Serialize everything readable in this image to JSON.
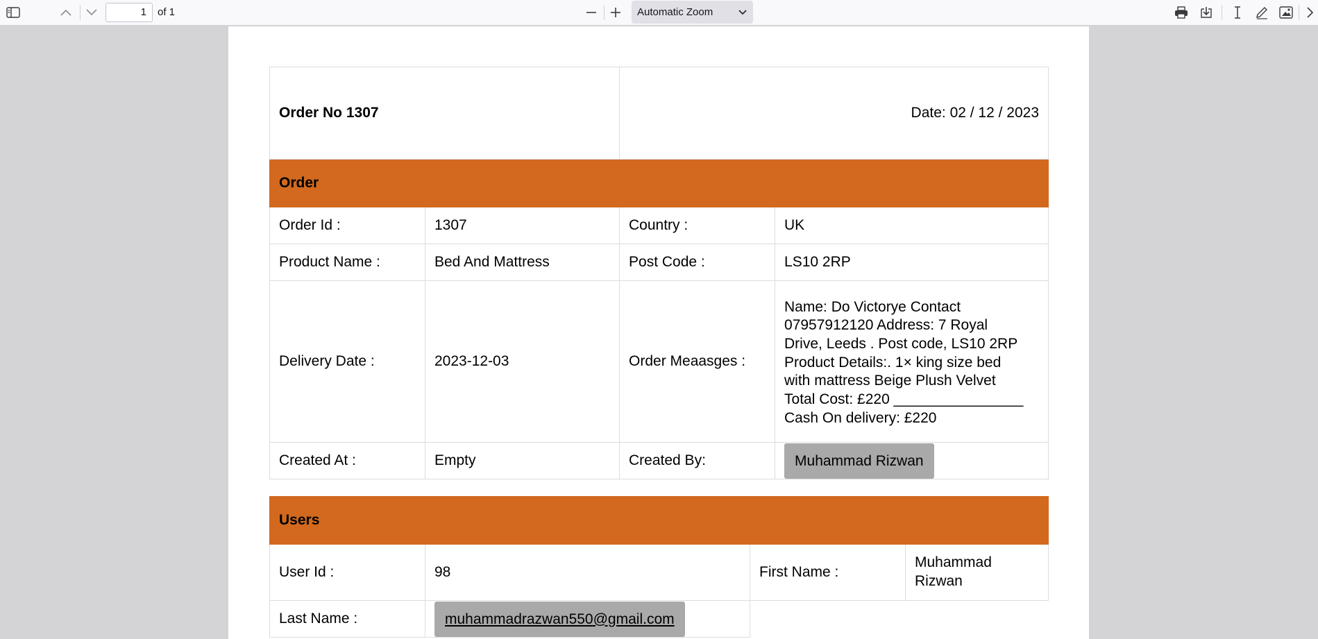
{
  "toolbar": {
    "page_number": "1",
    "page_of": "of 1",
    "zoom_label": "Automatic Zoom",
    "icons": [
      "sidebar-toggle-icon",
      "previous-page-icon",
      "next-page-icon",
      "zoom-out-icon",
      "zoom-in-icon",
      "chevron-down-icon",
      "print-icon",
      "download-icon",
      "text-cursor-icon",
      "draw-icon",
      "image-icon",
      "more-tools-icon"
    ]
  },
  "header": {
    "title": "Order No 1307",
    "date": "Date: 02 / 12 / 2023"
  },
  "order": {
    "section_title": "Order",
    "order_id_label": "Order Id :",
    "order_id": "1307",
    "country_label": "Country :",
    "country": "UK",
    "product_name_label": "Product Name :",
    "product_name": "Bed And Mattress",
    "post_code_label": "Post Code :",
    "post_code": "LS10 2RP",
    "delivery_date_label": "Delivery Date :",
    "delivery_date": "2023-12-03",
    "order_messages_label": "Order Meaasges :",
    "order_messages": [
      "Name: Do Victorye Contact",
      "07957912120 Address: 7 Royal",
      "Drive, Leeds . Post code, LS10 2RP",
      "Product Details:. 1× king size bed",
      "with mattress Beige Plush Velvet",
      "Total Cost: £220 ________________",
      "Cash On delivery: £220"
    ],
    "created_at_label": "Created At :",
    "created_at": "Empty",
    "created_by_label": "Created By:",
    "created_by": "Muhammad Rizwan"
  },
  "users": {
    "section_title": "Users",
    "user_id_label": "User Id :",
    "user_id": "98",
    "first_name_label": "First Name :",
    "first_name_line1": "Muhammad",
    "first_name_line2": "Rizwan",
    "last_name_label": "Last Name :",
    "last_name_value": "muhammadrazwan550@gmail.com"
  },
  "colors": {
    "band": "#d2691e",
    "chip": "#a9a9a9",
    "viewer_bg": "#d4d4d7"
  }
}
